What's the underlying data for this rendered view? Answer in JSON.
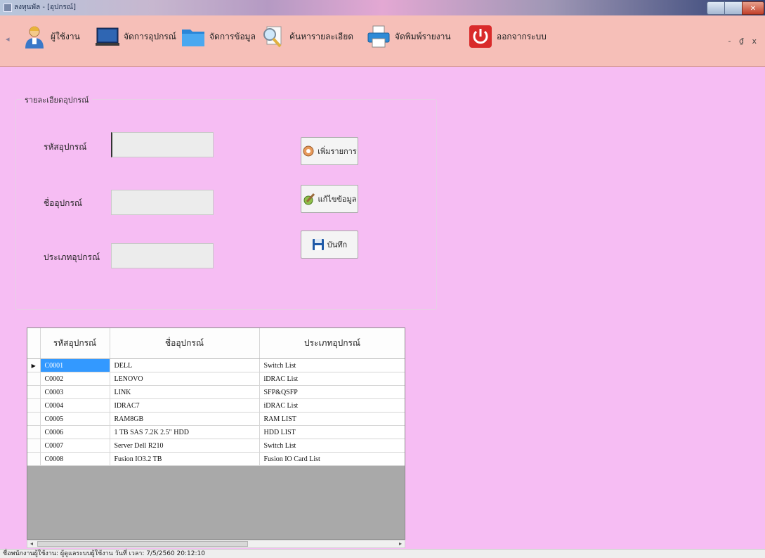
{
  "window": {
    "title": "ลงทุนพัล - [อุปกรณ์]"
  },
  "menu": {
    "items": [
      {
        "label": "ผู้ใช้งาน",
        "icon": "user-icon"
      },
      {
        "label": "จัดการอุปกรณ์",
        "icon": "laptop-icon"
      },
      {
        "label": "จัดการข้อมูล",
        "icon": "folder-icon"
      },
      {
        "label": "ค้นหารายละเอียด",
        "icon": "search-icon"
      },
      {
        "label": "จัดพิมพ์รายงาน",
        "icon": "printer-icon"
      },
      {
        "label": "ออกจากระบบ",
        "icon": "power-icon"
      }
    ],
    "mdi_controls": "- ₫ x"
  },
  "form": {
    "legend": "รายละเอียดอุปกรณ์",
    "fields": [
      {
        "label": "รหัสอุปกรณ์",
        "value": ""
      },
      {
        "label": "ชื่ออุปกรณ์",
        "value": ""
      },
      {
        "label": "ประเภทอุปกรณ์",
        "value": ""
      }
    ],
    "buttons": [
      {
        "label": "เพิ่มรายการ",
        "icon": "add-icon"
      },
      {
        "label": "แก้ไขข้อมูล",
        "icon": "edit-icon"
      },
      {
        "label": "บันทึก",
        "icon": "save-icon"
      }
    ]
  },
  "grid": {
    "columns": [
      "รหัสอุปกรณ์",
      "ชื่ออุปกรณ์",
      "ประเภทอุปกรณ์"
    ],
    "rows": [
      [
        "C0001",
        "DELL",
        "Switch List"
      ],
      [
        "C0002",
        "LENOVO",
        "iDRAC List"
      ],
      [
        "C0003",
        "LINK",
        "SFP&QSFP"
      ],
      [
        "C0004",
        "IDRAC7",
        "iDRAC List"
      ],
      [
        "C0005",
        "RAM8GB",
        "RAM LIST"
      ],
      [
        "C0006",
        "1 TB SAS 7.2K 2.5\" HDD",
        "HDD LIST"
      ],
      [
        "C0007",
        "Server Dell R210",
        "Switch List"
      ],
      [
        "C0008",
        "Fusion IO3.2 TB",
        "Fusion IO Card List"
      ]
    ],
    "selected_row": 0
  },
  "status": {
    "text": "ชื่อพนักงานผู้ใช้งาน: ผู้ดูแลระบบผู้ใช้งาน  วันที่ เวลา: 7/5/2560 20:12:10"
  },
  "colors": {
    "background": "#f6bdf3",
    "menubar": "#f6bfb8",
    "selection": "#3399ff"
  }
}
